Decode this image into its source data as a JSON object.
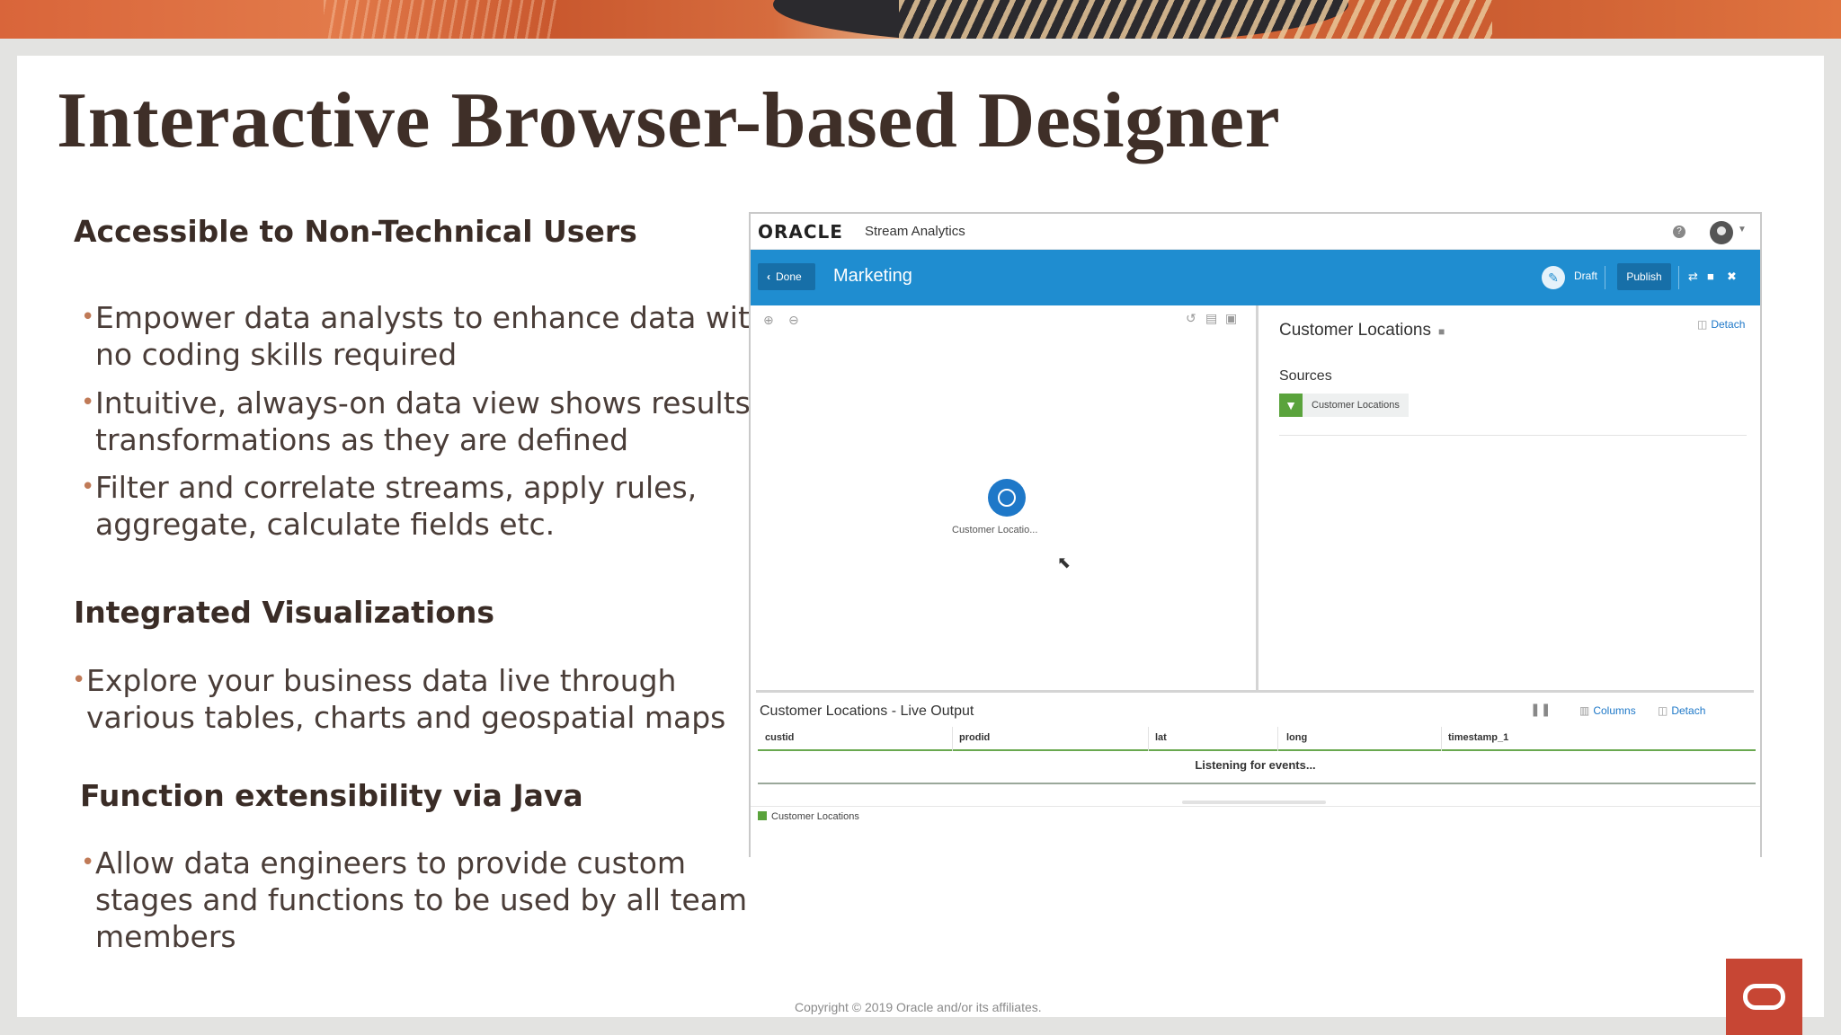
{
  "slide": {
    "title": "Interactive Browser-based Designer",
    "copyright": "Copyright © 2019 Oracle and/or its affiliates.",
    "sections": [
      {
        "heading": "Accessible to Non-Technical Users",
        "bullets": [
          [
            "Empower data analysts to enhance data with",
            "no coding skills required"
          ],
          [
            "Intuitive, always-on data view shows results of",
            "transformations as they are defined"
          ],
          [
            "Filter and correlate streams, apply rules,",
            "aggregate, calculate fields etc."
          ]
        ]
      },
      {
        "heading": "Integrated Visualizations",
        "bullets": [
          [
            "Explore your business data live through",
            "various tables, charts and geospatial maps"
          ]
        ]
      },
      {
        "heading": "Function extensibility via Java",
        "bullets": [
          [
            "Allow data engineers to provide custom",
            "stages and functions to be used by all team",
            "members"
          ]
        ]
      }
    ]
  },
  "app": {
    "logo": "ORACLE",
    "product": "Stream Analytics",
    "help_icon": "?",
    "toolbar": {
      "done_label": "Done",
      "pipeline_name": "Marketing",
      "status": "Draft",
      "publish_label": "Publish"
    },
    "canvas": {
      "node_label": "Customer Locatio..."
    },
    "properties": {
      "title": "Customer Locations",
      "detach_label": "Detach",
      "sources_label": "Sources",
      "source_chip": "Customer Locations"
    },
    "live_output": {
      "title": "Customer Locations - Live Output",
      "columns_label": "Columns",
      "detach_label": "Detach",
      "headers": [
        "custid",
        "prodid",
        "lat",
        "long",
        "timestamp_1"
      ],
      "status_message": "Listening for events...",
      "legend": "Customer Locations"
    }
  },
  "colors": {
    "brand_red": "#c74634",
    "toolbar_blue": "#1f8dd0",
    "source_green": "#5aa33c",
    "title_brown": "#3f2f28"
  }
}
